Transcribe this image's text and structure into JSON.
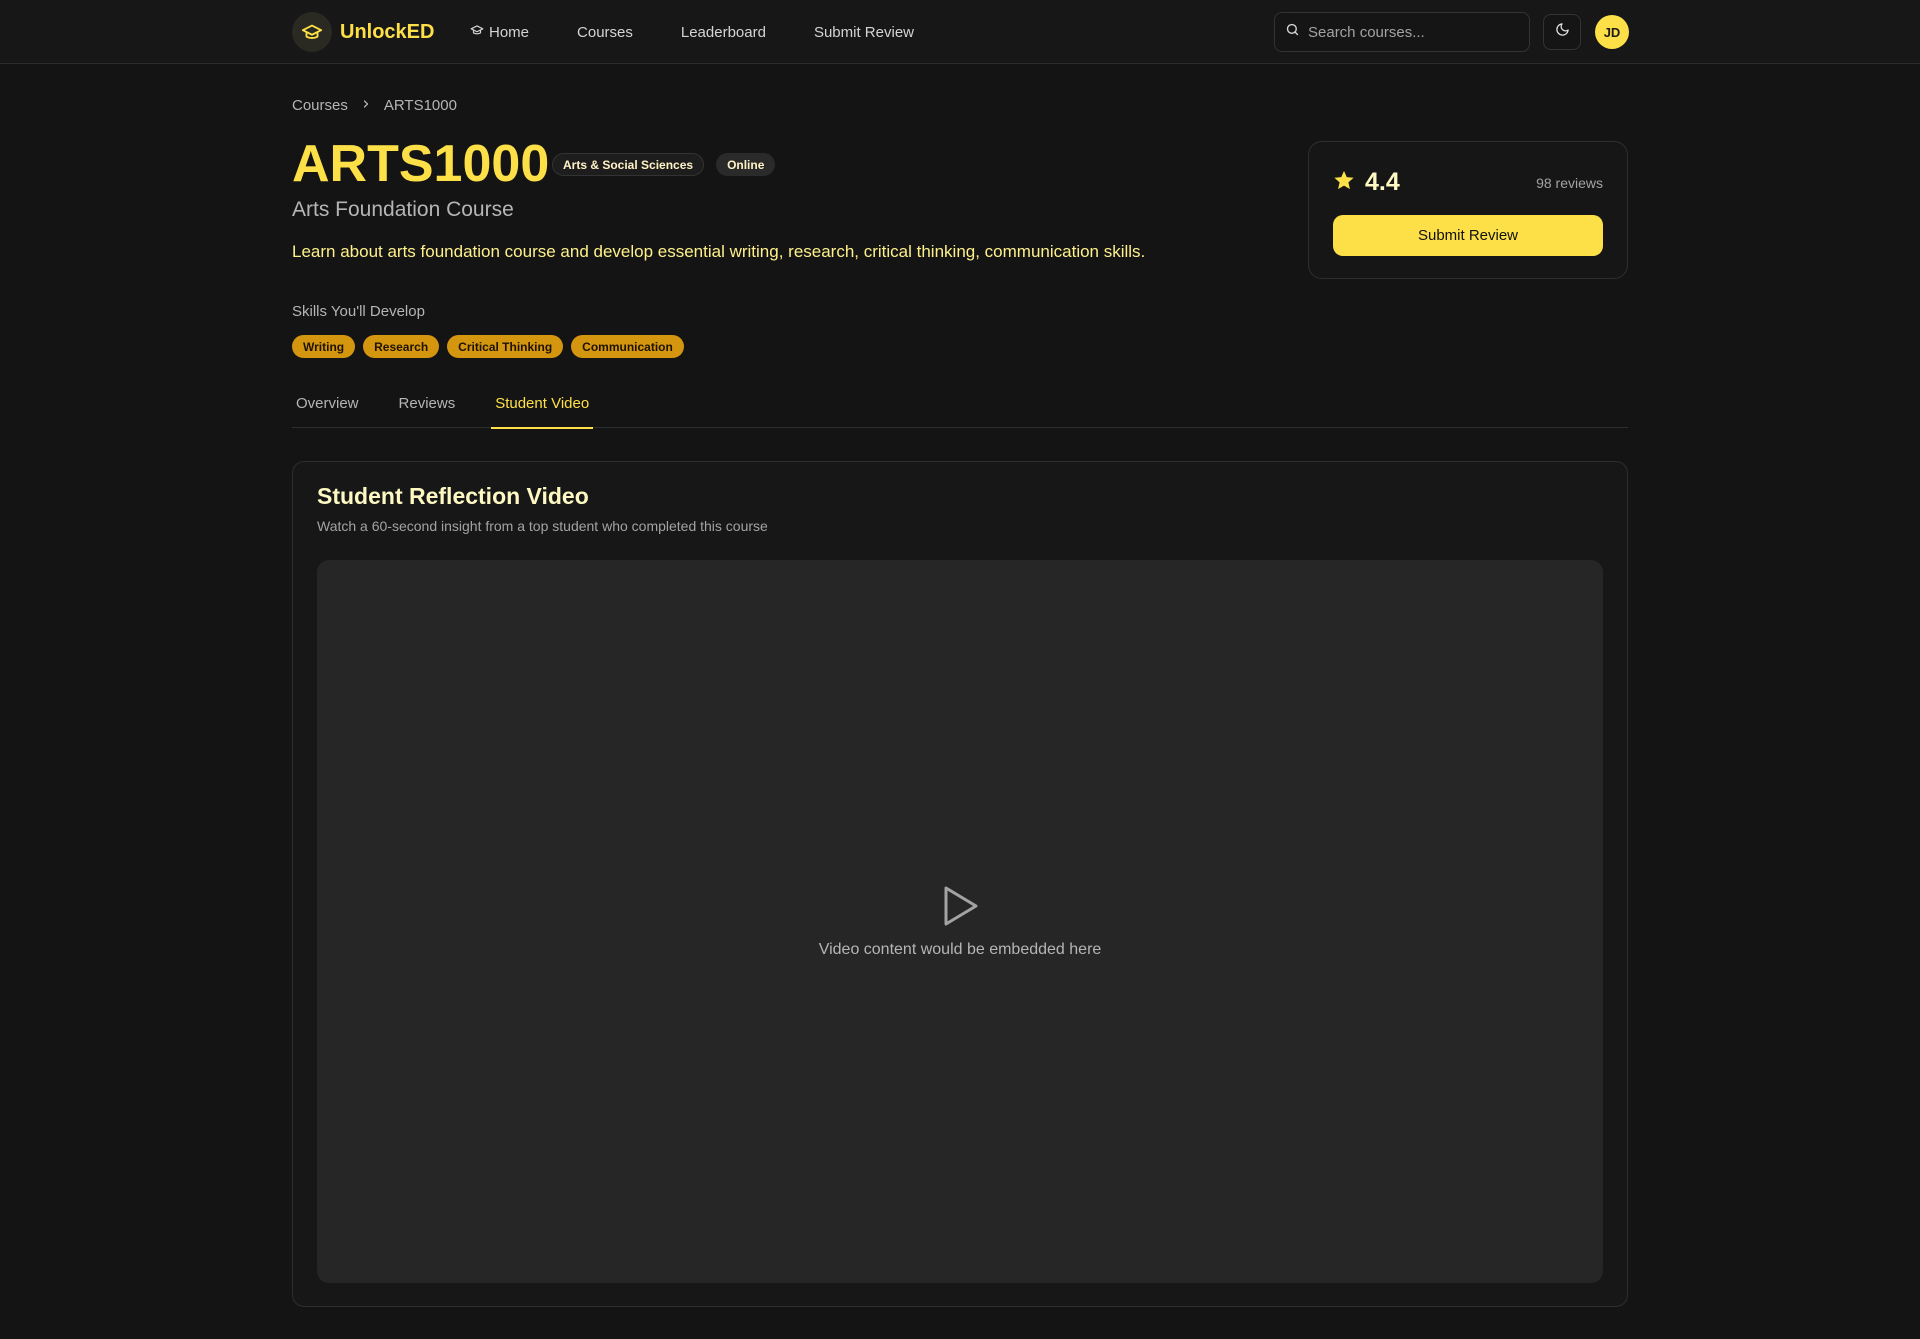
{
  "nav": {
    "brand": "UnlockED",
    "links": [
      "Home",
      "Courses",
      "Leaderboard",
      "Submit Review"
    ],
    "search_placeholder": "Search courses...",
    "avatar_initials": "JD",
    "accent_color": "#fde047"
  },
  "breadcrumb": [
    "Courses",
    "ARTS1000"
  ],
  "course": {
    "code": "ARTS1000",
    "badges": [
      "Arts & Social Sciences",
      "Online"
    ],
    "title": "Arts Foundation Course",
    "description": "Learn about arts foundation course and develop essential writing, research, critical thinking, communication skills.",
    "skills_heading": "Skills You'll Develop",
    "skills": [
      "Writing",
      "Research",
      "Critical Thinking",
      "Communication"
    ]
  },
  "rating": {
    "value": "4.4",
    "count_label": "98 reviews",
    "submit_label": "Submit Review"
  },
  "tabs": {
    "items": [
      "Overview",
      "Reviews",
      "Student Video"
    ],
    "active": "Student Video"
  },
  "video": {
    "title": "Student Reflection Video",
    "subtitle": "Watch a 60-second insight from a top student who completed this course",
    "placeholder": "Video content would be embedded here"
  }
}
